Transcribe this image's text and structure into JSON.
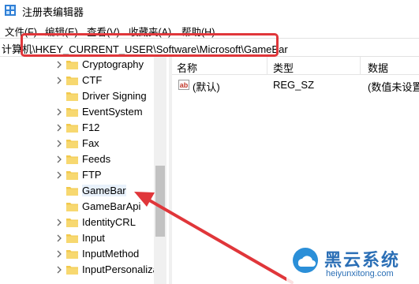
{
  "window": {
    "title": "注册表编辑器"
  },
  "menu": [
    "文件(F)",
    "编辑(E)",
    "查看(V)",
    "收藏夹(A)",
    "帮助(H)"
  ],
  "address": {
    "path": "计算机\\HKEY_CURRENT_USER\\Software\\Microsoft\\GameBar"
  },
  "tree": {
    "items": [
      "Cryptography",
      "CTF",
      "Driver Signing",
      "EventSystem",
      "F12",
      "Fax",
      "Feeds",
      "FTP",
      "GameBar",
      "GameBarApi",
      "IdentityCRL",
      "Input",
      "InputMethod",
      "InputPersonaliza"
    ],
    "selected": "GameBar"
  },
  "list": {
    "columns": [
      "名称",
      "类型",
      "数据"
    ],
    "rows": [
      {
        "name": "(默认)",
        "type": "REG_SZ",
        "data": "(数值未设置"
      }
    ]
  },
  "watermark": {
    "title": "黑云系统",
    "url": "heiyunxitong.com"
  },
  "colors": {
    "highlight": "#e0363a",
    "folder": "#f2c94c",
    "watermark": "#2b6fb6"
  }
}
